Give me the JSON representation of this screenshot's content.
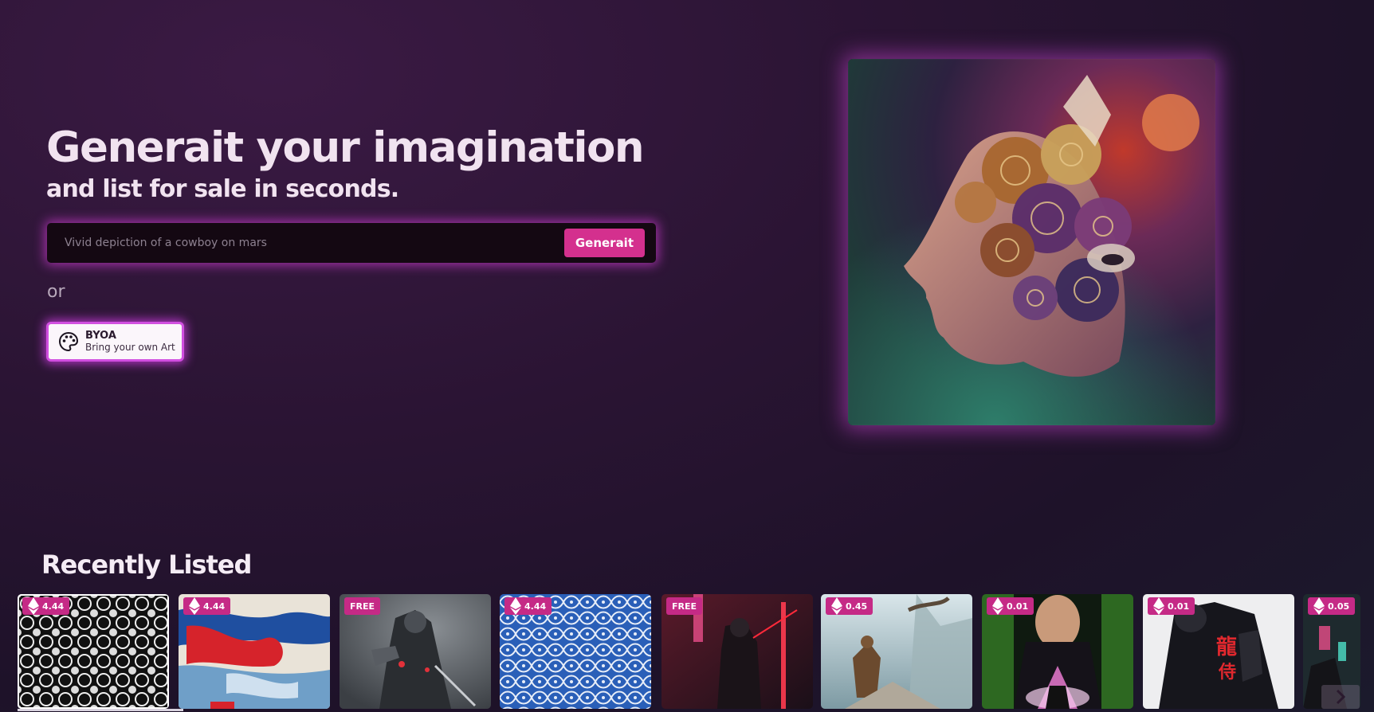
{
  "hero": {
    "title": "Generait your imagination",
    "subtitle": "and list for sale in seconds."
  },
  "prompt": {
    "placeholder": "Vivid depiction of a cowboy on mars",
    "button_label": "Generait"
  },
  "or_text": "or",
  "byoa": {
    "title": "BYOA",
    "subtitle": "Bring your own Art",
    "icon": "palette-icon"
  },
  "recently_listed": {
    "title": "Recently Listed",
    "cards": [
      {
        "price": "4.44",
        "currency_icon": "eth-icon",
        "art": "black-white-pattern"
      },
      {
        "price": "4.44",
        "currency_icon": "eth-icon",
        "art": "abstract-red-blue-paint"
      },
      {
        "price": "FREE",
        "currency_icon": "",
        "art": "armored-samurai"
      },
      {
        "price": "4.44",
        "currency_icon": "eth-icon",
        "art": "blue-white-pattern"
      },
      {
        "price": "FREE",
        "currency_icon": "",
        "art": "neon-alley-figure"
      },
      {
        "price": "0.45",
        "currency_icon": "eth-icon",
        "art": "dragon-warrior-landscape"
      },
      {
        "price": "0.01",
        "currency_icon": "eth-icon",
        "art": "ninja-portrait-green"
      },
      {
        "price": "0.01",
        "currency_icon": "eth-icon",
        "art": "ninja-red-kanji"
      },
      {
        "price": "0.05",
        "currency_icon": "eth-icon",
        "art": "neon-city-partial"
      }
    ]
  },
  "colors": {
    "accent": "#d4308e",
    "glow": "#c53ac8",
    "background": "#2a1433"
  }
}
